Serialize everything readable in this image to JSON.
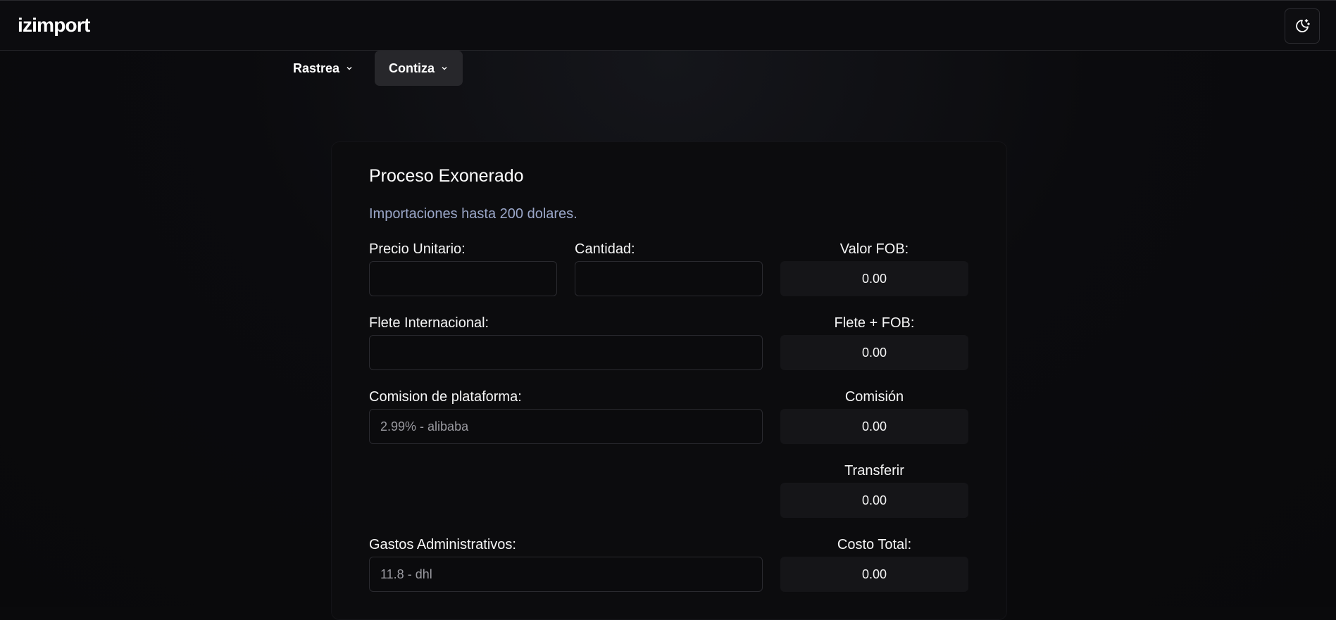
{
  "header": {
    "logo": "izimport",
    "theme_icon": "moon-stars-icon"
  },
  "nav": [
    {
      "label": "Rastrea",
      "icon": "chevron-down-icon"
    },
    {
      "label": "Contiza",
      "icon": "chevron-down-icon"
    }
  ],
  "card": {
    "title": "Proceso Exonerado",
    "subtitle": "Importaciones hasta 200 dolares.",
    "fields": {
      "precio_unitario": {
        "label": "Precio Unitario:",
        "value": ""
      },
      "cantidad": {
        "label": "Cantidad:",
        "value": ""
      },
      "flete_internacional": {
        "label": "Flete Internacional:",
        "value": ""
      },
      "comision_plataforma": {
        "label": "Comision de plataforma:",
        "placeholder": "2.99% - alibaba"
      },
      "gastos_administrativos": {
        "label": "Gastos Administrativos:",
        "placeholder": "11.8 - dhl"
      }
    },
    "results": {
      "valor_fob": {
        "label": "Valor FOB:",
        "value": "0.00"
      },
      "flete_fob": {
        "label": "Flete + FOB:",
        "value": "0.00"
      },
      "comision": {
        "label": "Comisión",
        "value": "0.00"
      },
      "transferir": {
        "label": "Transferir",
        "value": "0.00"
      },
      "costo_total": {
        "label": "Costo Total:",
        "value": "0.00"
      }
    }
  }
}
